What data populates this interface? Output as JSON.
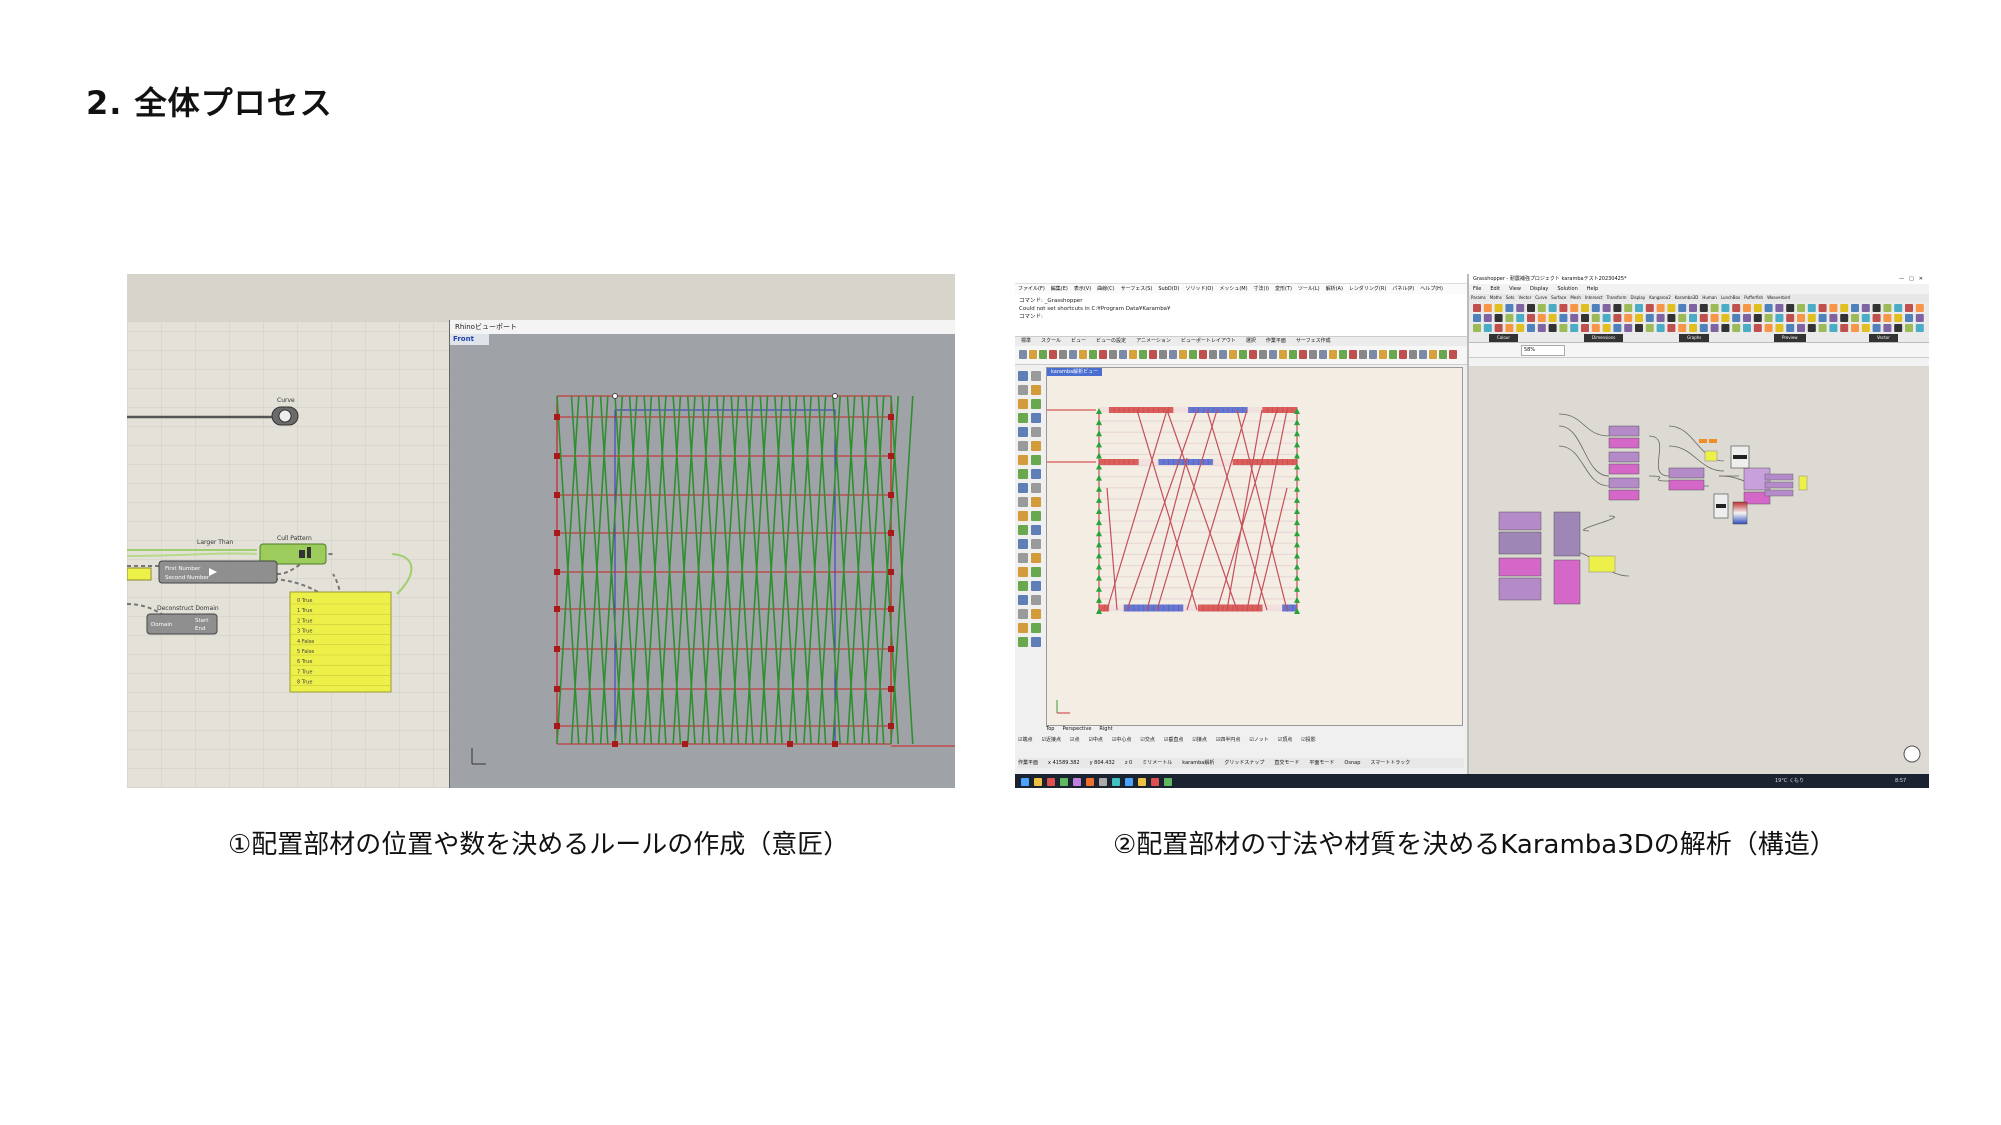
{
  "page": {
    "title": "2. 全体プロセス"
  },
  "figure1": {
    "caption": "①配置部材の位置や数を決めるルールの作成（意匠）",
    "viewport_title": "Rhinoビューポート",
    "viewport_tab": "Front",
    "nodes": {
      "curve": "Curve",
      "cull_pattern": "Cull Pattern",
      "larger_than": "Larger Than",
      "first_number": "First Number",
      "second_number": "Second Number",
      "deconstruct_domain": "Deconstruct Domain",
      "domain": "Domain",
      "start": "Start",
      "end": "End"
    },
    "panel_rows": [
      "0 True",
      "1 True",
      "2 True",
      "3 True",
      "4 False",
      "5 False",
      "6 True",
      "7 True",
      "8 True"
    ],
    "colors": {
      "grid_lines": "#2f8f2f",
      "frame_lines": "#cc2222",
      "boundary": "#3333cc",
      "panel": "#eef04a",
      "viewport_bg": "#9fa3a8"
    }
  },
  "figure2": {
    "caption": "②配置部材の寸法や材質を決めるKaramba3Dの解析（構造）",
    "rhino_menu": [
      "ファイル(F)",
      "編集(E)",
      "表示(V)",
      "曲線(C)",
      "サーフェス(S)",
      "SubD(D)",
      "ソリッド(O)",
      "メッシュ(M)",
      "寸法(I)",
      "変形(T)",
      "ツール(L)",
      "解析(A)",
      "レンダリング(R)",
      "パネル(P)",
      "ヘルプ(H)"
    ],
    "command_lines": [
      "コマンド: _Grasshopper",
      "Could not set shortcuts in C:¥Program Data¥Karamba¥",
      "コマンド:"
    ],
    "rhino_tabs": [
      "標準",
      "スクール",
      "ビュー",
      "ビューの設定",
      "アニメーション",
      "ビューポートレイアウト",
      "選択",
      "作業平面",
      "サーフェス作成"
    ],
    "viewport_label": "karamba解析ビュー",
    "view_tabs": [
      "Top",
      "Perspective",
      "Right"
    ],
    "osnap": [
      "端点",
      "近接点",
      "点",
      "中点",
      "中心点",
      "交点",
      "垂直点",
      "接点",
      "四半円点",
      "ノット",
      "頂点",
      "投影"
    ],
    "status": [
      "作業平面",
      "x 41589.382",
      "y 804.432",
      "z 0",
      "ミリメートル",
      "karamba解析",
      "グリッドスナップ",
      "直交モード",
      "平面モード",
      "Osnap",
      "スマートトラック"
    ],
    "gh_title": "Grasshopper - 耐震補強プロジェクト karambaテスト20230425*",
    "gh_menu": [
      "File",
      "Edit",
      "View",
      "Display",
      "Solution",
      "Help"
    ],
    "gh_tabs": [
      "Params",
      "Maths",
      "Sets",
      "Vector",
      "Curve",
      "Surface",
      "Mesh",
      "Intersect",
      "Transform",
      "Display",
      "Kangaroo2",
      "Karamba3D",
      "Human",
      "LunchBox",
      "Pufferfish",
      "Weaverbird"
    ],
    "gh_groups": [
      "Colour",
      "Dimensions",
      "Graphs",
      "Preview",
      "Vector"
    ],
    "gh_zoom": "58%",
    "taskbar": {
      "weather": "19°C くもり",
      "time": "8:57"
    },
    "colors": {
      "members": "#c4505a",
      "tension": "#3b50c8",
      "compression": "#d03030",
      "supports": "#27a33a",
      "canvas": "#dcdad2"
    }
  }
}
